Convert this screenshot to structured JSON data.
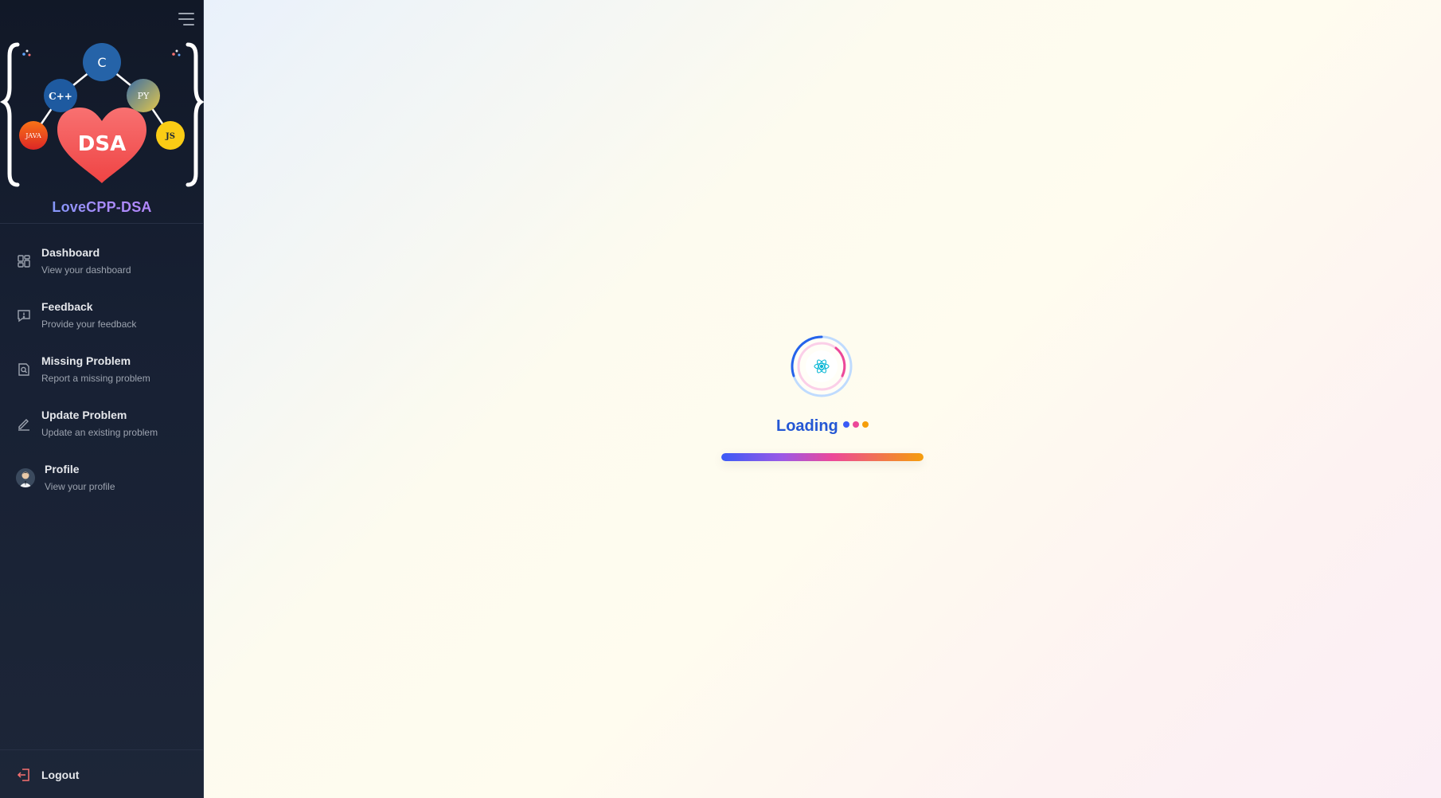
{
  "app": {
    "brand": "LoveCPP-DSA"
  },
  "logo": {
    "center": "DSA",
    "nodes": [
      "C",
      "C++",
      "PY",
      "JAVA",
      "JS"
    ]
  },
  "sidebar": {
    "items": [
      {
        "label": "Dashboard",
        "sub": "View your dashboard",
        "icon": "dashboard-icon"
      },
      {
        "label": "Feedback",
        "sub": "Provide your feedback",
        "icon": "feedback-icon"
      },
      {
        "label": "Missing Problem",
        "sub": "Report a missing problem",
        "icon": "search-document-icon"
      },
      {
        "label": "Update Problem",
        "sub": "Update an existing problem",
        "icon": "pencil-icon"
      },
      {
        "label": "Profile",
        "sub": "View your profile",
        "icon": "avatar"
      }
    ],
    "logout": "Logout"
  },
  "loader": {
    "label": "Loading",
    "icon": "react-atom-icon",
    "progress": 1.0
  },
  "colors": {
    "sidebar_bg": "#111827",
    "accent_blue": "#2457d4",
    "dot_blue": "#3b5bf6",
    "dot_pink": "#ec4899",
    "dot_amber": "#f59e0b"
  }
}
